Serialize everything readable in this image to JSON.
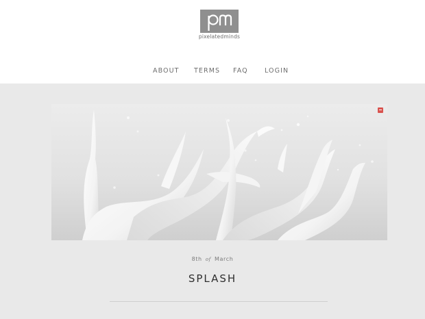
{
  "site": {
    "logo_wordmark": "pixelatedminds",
    "logo_initials": "pm"
  },
  "nav": {
    "items": [
      {
        "label": "ABOUT"
      },
      {
        "label": "TERMS"
      },
      {
        "label": "FAQ"
      },
      {
        "label": "LOGIN"
      }
    ]
  },
  "post": {
    "image_alt": "white liquid splash",
    "date_day": "8th",
    "date_of": "of",
    "date_month": "March",
    "title": "SPLASH"
  },
  "colors": {
    "logo_box": "#8f8f8f",
    "page_background": "#e9e9e9",
    "badge": "#d9534f"
  }
}
